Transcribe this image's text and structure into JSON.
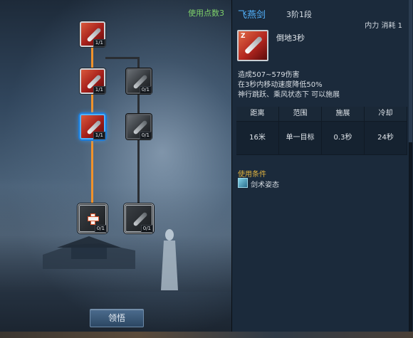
{
  "tree": {
    "points_used": "使用点数3",
    "learn_button": "领悟",
    "nodes": [
      {
        "id": "root",
        "badge": "1/1",
        "state": "learned"
      },
      {
        "id": "left-2",
        "badge": "1/1",
        "state": "learned"
      },
      {
        "id": "left-3",
        "badge": "1/1",
        "state": "learned-selected"
      },
      {
        "id": "left-4",
        "badge": "0/1",
        "state": "available"
      },
      {
        "id": "right-2",
        "badge": "0/1",
        "state": "locked"
      },
      {
        "id": "right-3",
        "badge": "0/1",
        "state": "locked"
      },
      {
        "id": "right-4",
        "badge": "0/1",
        "state": "locked"
      }
    ],
    "colors": {
      "active_path": "#f0922b",
      "locked_path": "#2a2e33"
    }
  },
  "skill": {
    "name": "飞燕剑",
    "rank": "3阶1段",
    "cost": "内力 消耗 1",
    "key": "Z",
    "sub_title": "倒地3秒",
    "desc_lines": [
      "造成507~579伤害",
      "在3秒内移动速度降低50%",
      "神行跳跃、乘风状态下 可以施展"
    ],
    "stats_headers": [
      "距离",
      "范围",
      "施展",
      "冷却"
    ],
    "stats_values": [
      "16米",
      "单一目标",
      "0.3秒",
      "24秒"
    ],
    "cond_title": "使用条件",
    "cond_text": "剑术姿态",
    "colors": {
      "name": "#53b4ff",
      "cond_title": "#e0b23f"
    }
  }
}
